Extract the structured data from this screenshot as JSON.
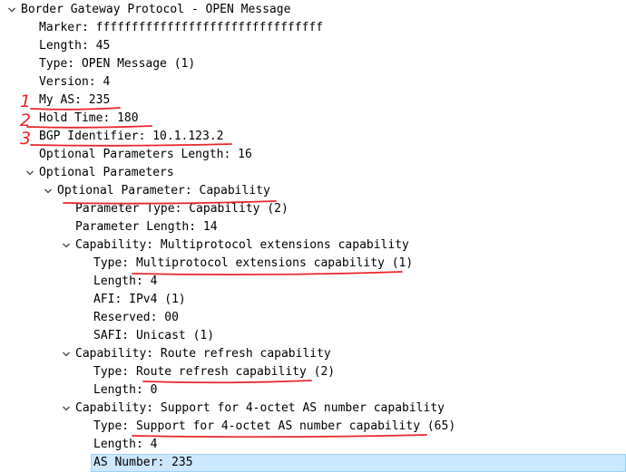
{
  "tree": {
    "rows": [
      {
        "text": "Border Gateway Protocol - OPEN Message",
        "expander": "expanded"
      },
      {
        "text": "Marker: ffffffffffffffffffffffffffffffff",
        "expander": "none"
      },
      {
        "text": "Length: 45",
        "expander": "none"
      },
      {
        "text": "Type: OPEN Message (1)",
        "expander": "none"
      },
      {
        "text": "Version: 4",
        "expander": "none"
      },
      {
        "text": "My AS: 235",
        "expander": "none"
      },
      {
        "text": "Hold Time: 180",
        "expander": "none"
      },
      {
        "text": "BGP Identifier: 10.1.123.2",
        "expander": "none"
      },
      {
        "text": "Optional Parameters Length: 16",
        "expander": "none"
      },
      {
        "text": "Optional Parameters",
        "expander": "expanded"
      },
      {
        "text": "Optional Parameter: Capability",
        "expander": "expanded"
      },
      {
        "text": "Parameter Type: Capability (2)",
        "expander": "none"
      },
      {
        "text": "Parameter Length: 14",
        "expander": "none"
      },
      {
        "text": "Capability: Multiprotocol extensions capability",
        "expander": "expanded"
      },
      {
        "text": "Type: Multiprotocol extensions capability (1)",
        "expander": "none"
      },
      {
        "text": "Length: 4",
        "expander": "none"
      },
      {
        "text": "AFI: IPv4 (1)",
        "expander": "none"
      },
      {
        "text": "Reserved: 00",
        "expander": "none"
      },
      {
        "text": "SAFI: Unicast (1)",
        "expander": "none"
      },
      {
        "text": "Capability: Route refresh capability",
        "expander": "expanded"
      },
      {
        "text": "Type: Route refresh capability (2)",
        "expander": "none"
      },
      {
        "text": "Length: 0",
        "expander": "none"
      },
      {
        "text": "Capability: Support for 4-octet AS number capability",
        "expander": "expanded"
      },
      {
        "text": "Type: Support for 4-octet AS number capability (65)",
        "expander": "none"
      },
      {
        "text": "Length: 4",
        "expander": "none"
      },
      {
        "text": "AS Number: 235",
        "expander": "none",
        "selected": true
      }
    ]
  },
  "annotations": {
    "numbers": [
      "1",
      "2",
      "3"
    ]
  },
  "colors": {
    "annotation": "#e8262a",
    "selection_bg": "#cce8ff",
    "selection_border": "#99d1ff",
    "chevron": "#444444"
  }
}
